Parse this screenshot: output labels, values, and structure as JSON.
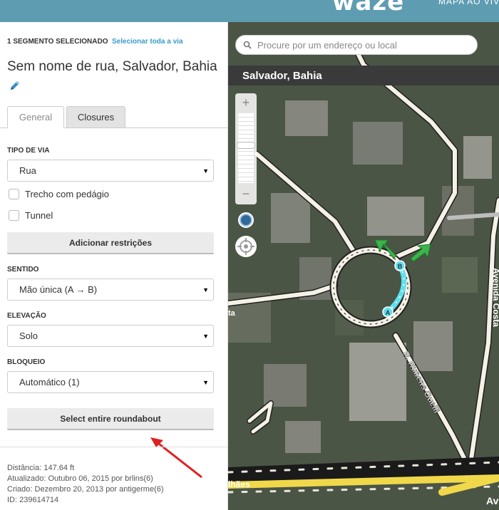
{
  "header": {
    "logo": "waze",
    "live_map_link": "MAPA AO VIVO"
  },
  "panel": {
    "selection_count": "1 SEGMENTO SELECIONADO",
    "select_all_link": "Selecionar toda a via",
    "segment_title": "Sem nome de rua, Salvador, Bahia",
    "tabs": [
      {
        "label": "General",
        "active": true
      },
      {
        "label": "Closures",
        "active": false
      }
    ],
    "road_type": {
      "label": "TIPO DE VIA",
      "value": "Rua"
    },
    "checkboxes": [
      {
        "label": "Trecho com pedágio",
        "checked": false
      },
      {
        "label": "Tunnel",
        "checked": false
      }
    ],
    "add_restrictions_button": "Adicionar restrições",
    "direction": {
      "label": "SENTIDO",
      "value": "Mão única (A → B)"
    },
    "elevation": {
      "label": "ELEVAÇÃO",
      "value": "Solo"
    },
    "lock": {
      "label": "BLOQUEIO",
      "value": "Automático (1)"
    },
    "select_roundabout_button": "Select entire roundabout",
    "info": {
      "distance": "Distância: 147.64 ft",
      "updated": "Atualizado: Outubro 06, 2015 por brlins(6)",
      "created": "Criado: Dezembro 20, 2013 por antigerme(6)",
      "id": "ID: 239614714"
    }
  },
  "map": {
    "search_placeholder": "Procure por um endereço ou local",
    "location": "Salvador, Bahia",
    "zoom_in": "+",
    "zoom_out": "−",
    "street_labels": [
      "R. Rubens Guelli",
      "Avenida Costa",
      "lhães",
      "Av",
      "ta"
    ],
    "node_a": "A",
    "node_b": "B",
    "colors": {
      "segment_highlight": "#5ee0f0",
      "arrow_green": "#3cb44b",
      "road_white": "#f4f1e6",
      "highway_yellow": "#f0d84a",
      "annotation_arrow": "#e02020"
    }
  }
}
